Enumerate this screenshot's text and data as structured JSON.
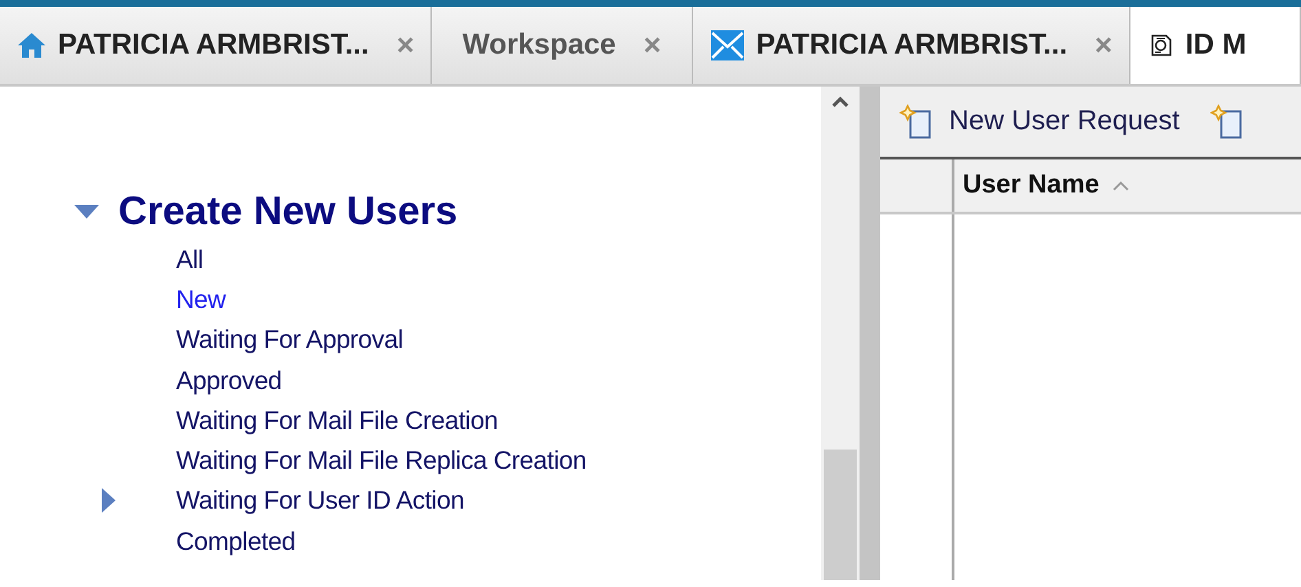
{
  "tabs": [
    {
      "label": "PATRICIA ARMBRIST...",
      "kind": "home",
      "close": "×",
      "selected": false
    },
    {
      "label": "Workspace",
      "kind": "plain",
      "close": "×",
      "selected": false
    },
    {
      "label": "PATRICIA ARMBRIST...",
      "kind": "mail",
      "close": "×",
      "selected": false
    },
    {
      "label": "ID M",
      "kind": "certificate",
      "selected": true
    }
  ],
  "navigator": {
    "section": {
      "title": "Create New Users",
      "expanded": true,
      "items": [
        {
          "label": "All",
          "selected": false,
          "marker": false
        },
        {
          "label": "New",
          "selected": true,
          "marker": false
        },
        {
          "label": "Waiting For Approval",
          "selected": false,
          "marker": false
        },
        {
          "label": "Approved",
          "selected": false,
          "marker": false
        },
        {
          "label": "Waiting For Mail File Creation",
          "selected": false,
          "marker": false
        },
        {
          "label": "Waiting For Mail File Replica Creation",
          "selected": false,
          "marker": false
        },
        {
          "label": "Waiting For User ID Action",
          "selected": false,
          "marker": true
        },
        {
          "label": "Completed",
          "selected": false,
          "marker": false
        }
      ]
    }
  },
  "toolbar": {
    "buttons": [
      "New User Request"
    ]
  },
  "table": {
    "columns": [
      {
        "label": "User Name",
        "sorted": true
      }
    ]
  }
}
